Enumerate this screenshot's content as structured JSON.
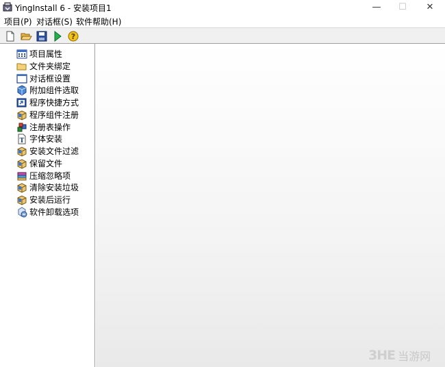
{
  "window": {
    "title": "YingInstall 6 - 安装项目1",
    "minimize_glyph": "—",
    "maximize_glyph": "☐",
    "close_glyph": "✕"
  },
  "menu": [
    "项目(P)",
    "对话框(S)",
    "软件帮助(H)"
  ],
  "toolbar": [
    {
      "icon": "new-file-icon"
    },
    {
      "icon": "open-folder-icon"
    },
    {
      "icon": "save-icon"
    },
    {
      "icon": "run-icon"
    },
    {
      "icon": "help-icon"
    }
  ],
  "tree": [
    {
      "label": "项目属性",
      "icon": "properties-icon"
    },
    {
      "label": "文件夹绑定",
      "icon": "folder-icon"
    },
    {
      "label": "对话框设置",
      "icon": "dialog-icon"
    },
    {
      "label": "附加组件选取",
      "icon": "component-icon"
    },
    {
      "label": "程序快捷方式",
      "icon": "shortcut-icon"
    },
    {
      "label": "程序组件注册",
      "icon": "package-icon"
    },
    {
      "label": "注册表操作",
      "icon": "registry-icon"
    },
    {
      "label": "字体安装",
      "icon": "font-icon"
    },
    {
      "label": "安装文件过滤",
      "icon": "package-icon"
    },
    {
      "label": "保留文件",
      "icon": "package-icon"
    },
    {
      "label": "压缩忽略项",
      "icon": "compress-icon"
    },
    {
      "label": "清除安装垃圾",
      "icon": "package-icon"
    },
    {
      "label": "安装后运行",
      "icon": "package-icon"
    },
    {
      "label": "软件卸载选项",
      "icon": "uninstall-icon"
    }
  ],
  "watermark": {
    "logo": "3HE",
    "text": "当游网"
  }
}
